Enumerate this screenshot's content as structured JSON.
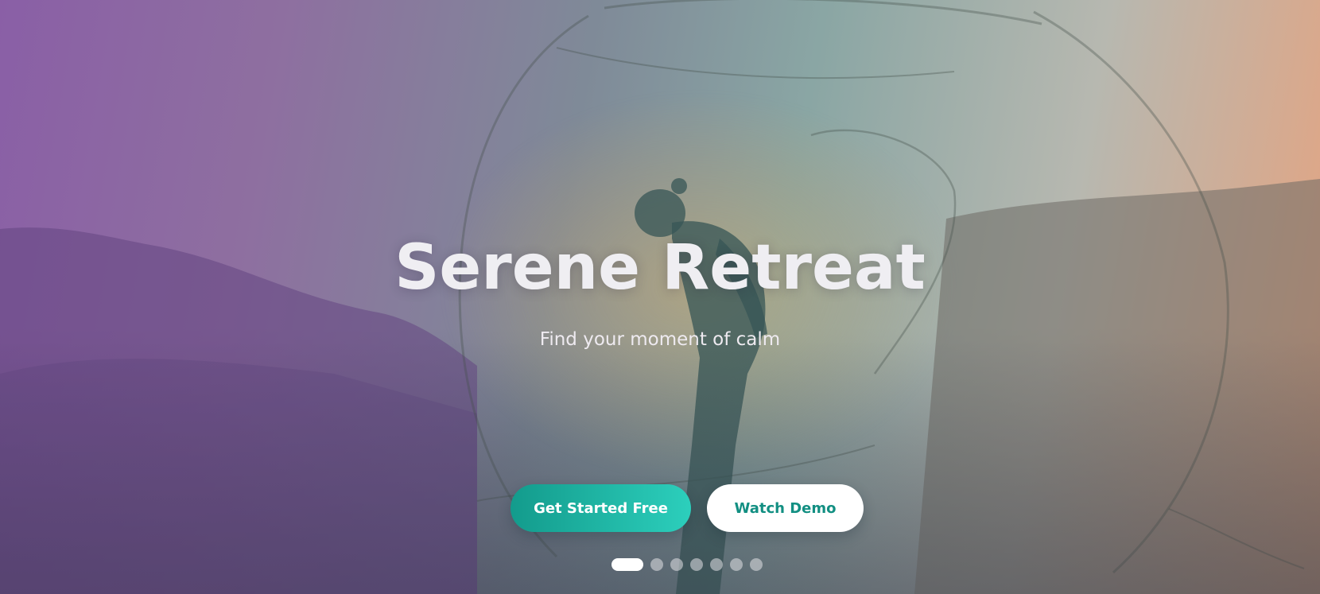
{
  "hero": {
    "title": "Serene Retreat",
    "subtitle": "Find your moment of calm",
    "primary_button": "Get Started Free",
    "secondary_button": "Watch Demo"
  },
  "carousel": {
    "slide_count": 7,
    "active_index": 0
  },
  "colors": {
    "accent": "#1fb5a4",
    "accent_text": "#128f82",
    "title": "#efeef2"
  }
}
